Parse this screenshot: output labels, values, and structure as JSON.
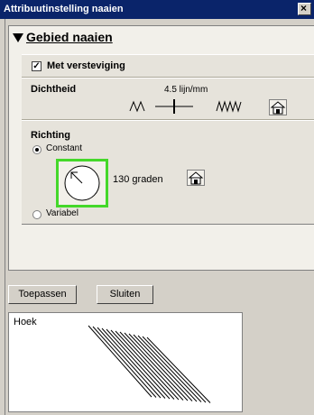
{
  "window": {
    "title": "Attribuutinstelling naaien"
  },
  "section": {
    "title": "Gebied naaien"
  },
  "reinforce": {
    "label": "Met versteviging",
    "checked": true
  },
  "density": {
    "label": "Dichtheid",
    "value": "4.5 lijn/mm"
  },
  "direction": {
    "label": "Richting",
    "constant_label": "Constant",
    "variable_label": "Variabel",
    "angle_text": "130 graden",
    "angle": 130
  },
  "buttons": {
    "apply": "Toepassen",
    "close": "Sluiten"
  },
  "preview": {
    "label": "Hoek"
  },
  "icons": [
    "close-icon",
    "home-icon",
    "dial-icon",
    "triangle-down-icon"
  ],
  "colors": {
    "titlebar": "#0a246a",
    "highlight": "#44d82a"
  }
}
